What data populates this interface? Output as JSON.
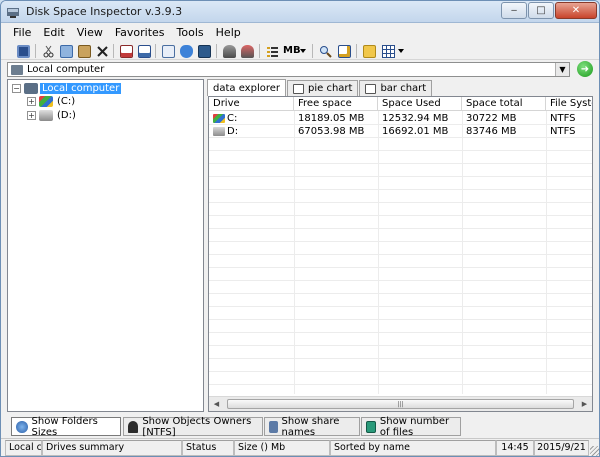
{
  "window": {
    "title": "Disk Space Inspector v.3.9.3",
    "controls": {
      "minimize": "‒",
      "maximize": "□",
      "close": "✕"
    }
  },
  "menu": [
    "File",
    "Edit",
    "View",
    "Favorites",
    "Tools",
    "Help"
  ],
  "toolbar": {
    "units_label": "MB",
    "icons": [
      "save-icon",
      "cut-icon",
      "copy-icon",
      "paste-icon",
      "delete-icon",
      "report-icon",
      "export-icon",
      "edit-icon",
      "shield-icon",
      "database-icon",
      "scan-icon",
      "disk-icon",
      "list-icon",
      "units-dropdown",
      "search-icon",
      "find-icon",
      "folder-open-icon",
      "grid-icon"
    ]
  },
  "address": {
    "value": "Local computer",
    "go_label": "➜"
  },
  "tree": {
    "root": "Local computer",
    "children": [
      "(C:)",
      "(D:)"
    ]
  },
  "tabs": [
    "data explorer",
    "pie chart",
    "bar chart"
  ],
  "list": {
    "columns": [
      "Drive",
      "Free space",
      "Space Used",
      "Space total",
      "File System"
    ],
    "rows": [
      {
        "drive": "C:",
        "free": "18189.05 MB",
        "used": "12532.94 MB",
        "total": "30722 MB",
        "fs": "NTFS"
      },
      {
        "drive": "D:",
        "free": "67053.98 MB",
        "used": "16692.01 MB",
        "total": "83746 MB",
        "fs": "NTFS"
      }
    ]
  },
  "scrollbar": {
    "thumb_grip": "|||"
  },
  "bottom_tabs": [
    "Show Folders Sizes",
    "Show Objects Owners [NTFS]",
    "Show share names",
    "Show number of files"
  ],
  "status": {
    "location": "Local co",
    "summary": "Drives summary",
    "status": "Status",
    "size": "Size () Mb",
    "sorted": "Sorted by name",
    "time": "14:45",
    "date": "2015/9/21"
  },
  "colors": {
    "selection": "#3399ff",
    "title_gradient_top": "#dbe8f6",
    "close_button": "#c8442c"
  }
}
